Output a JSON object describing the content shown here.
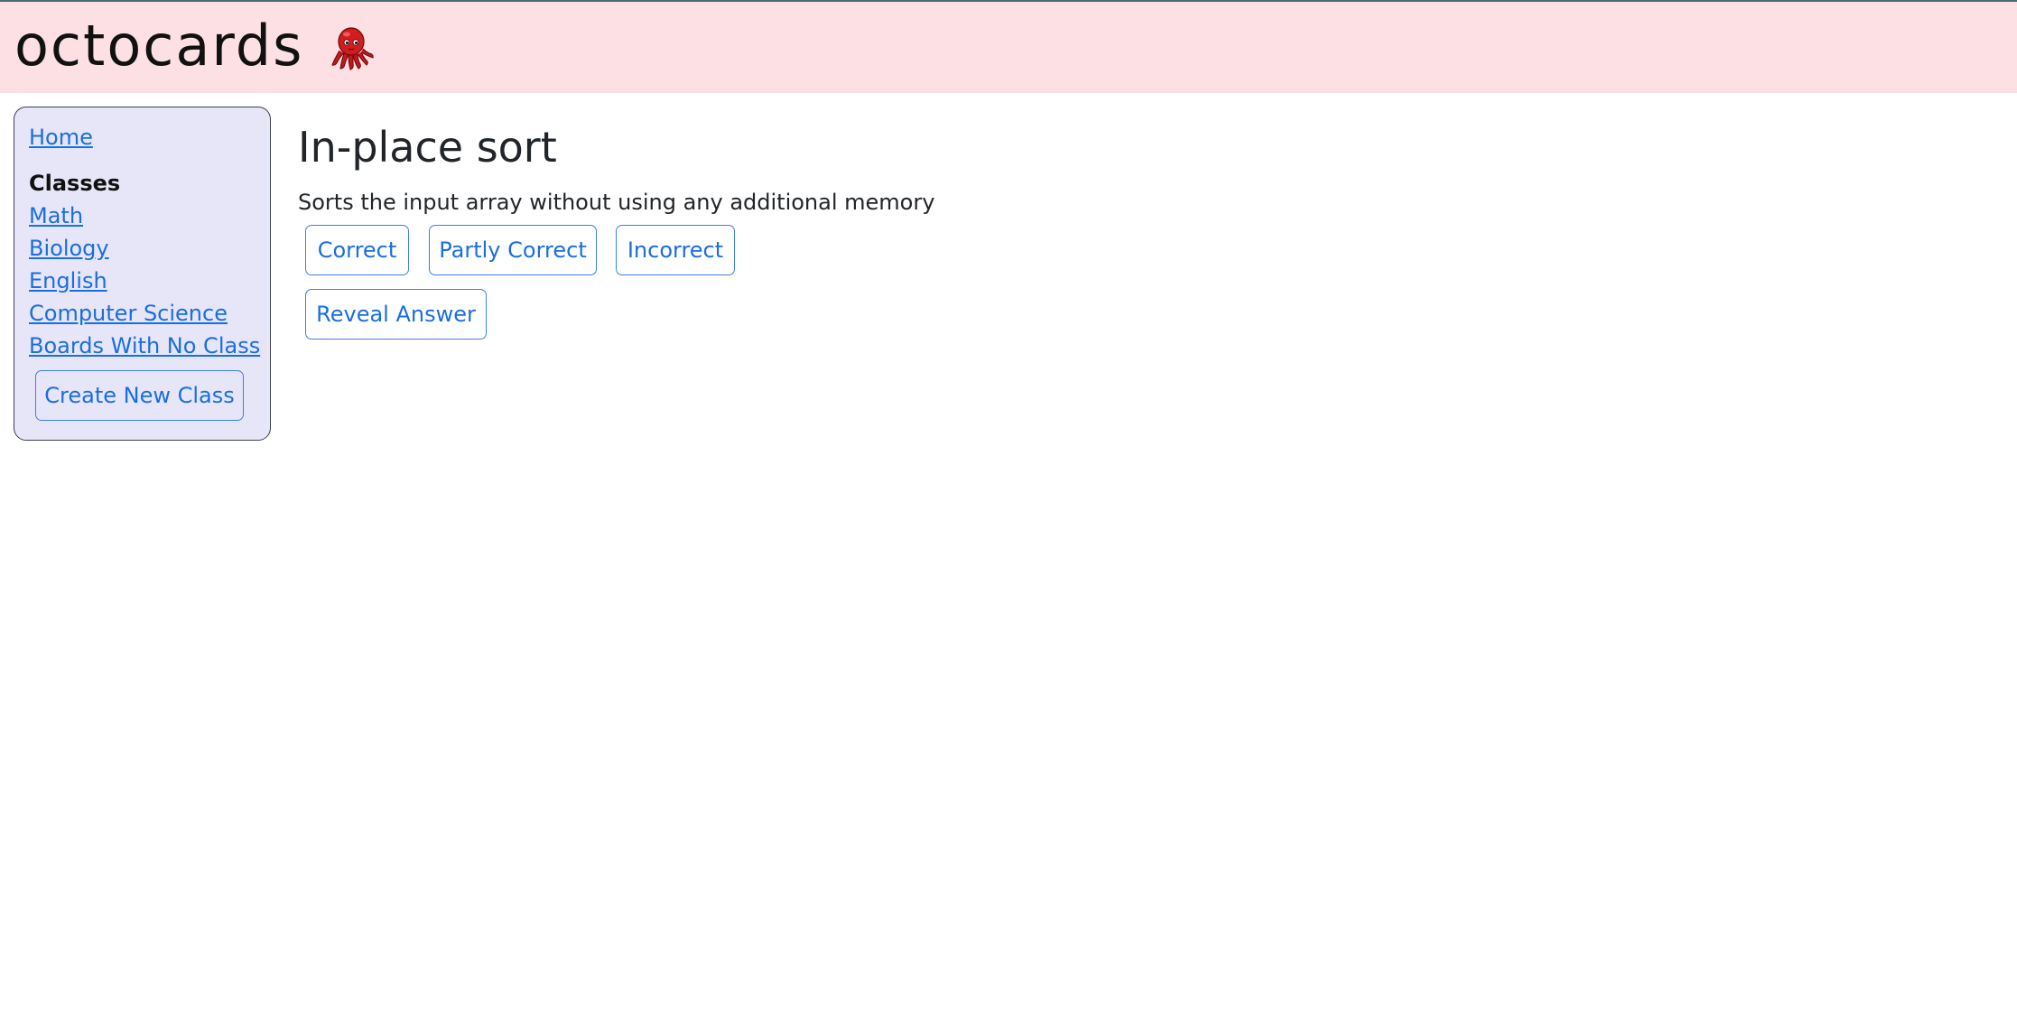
{
  "header": {
    "brand": "octocards",
    "logo_icon": "octopus-icon",
    "background": "#fde0e4"
  },
  "sidebar": {
    "home_label": "Home",
    "classes_heading": "Classes",
    "items": [
      {
        "label": "Math"
      },
      {
        "label": "Biology"
      },
      {
        "label": "English"
      },
      {
        "label": "Computer Science"
      },
      {
        "label": "Boards With No Class"
      }
    ],
    "create_button_label": "Create New Class",
    "background": "#e6e6f8"
  },
  "card": {
    "title": "In-place sort",
    "description": "Sorts the input array without using any additional memory",
    "buttons": {
      "correct": "Correct",
      "partly_correct": "Partly Correct",
      "incorrect": "Incorrect",
      "reveal": "Reveal Answer"
    }
  },
  "colors": {
    "link": "#1a6ee0",
    "button_border": "#3d7fe6"
  }
}
